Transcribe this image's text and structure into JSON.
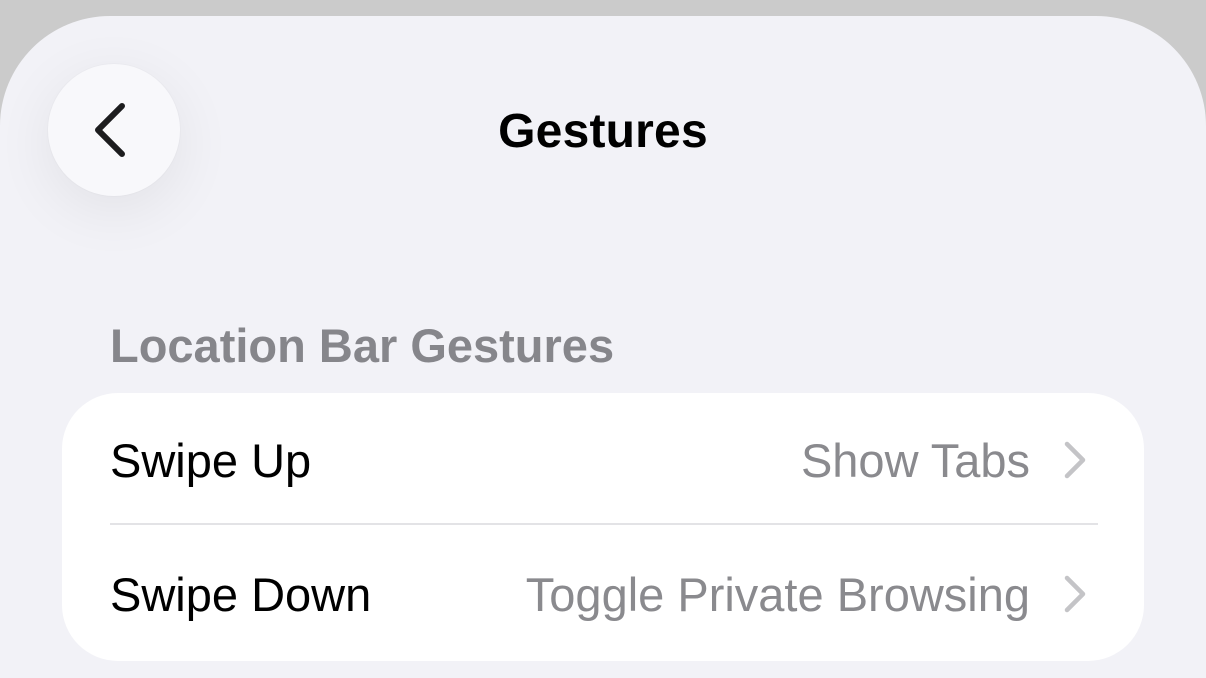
{
  "header": {
    "title": "Gestures",
    "back_icon": "chevron-left-icon"
  },
  "section": {
    "title": "Location Bar Gestures"
  },
  "rows": [
    {
      "label": "Swipe Up",
      "value": "Show Tabs",
      "icon": "chevron-right-icon"
    },
    {
      "label": "Swipe Down",
      "value": "Toggle Private Browsing",
      "icon": "chevron-right-icon"
    }
  ],
  "colors": {
    "background": "#f2f2f7",
    "card": "#ffffff",
    "secondary_text": "#8a8a8e",
    "section_header": "#86868b",
    "chevron": "#c4c4c7"
  }
}
